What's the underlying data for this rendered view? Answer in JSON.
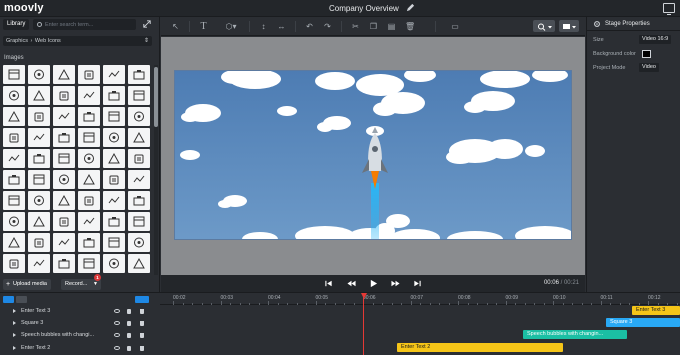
{
  "app": {
    "logo": "moovly",
    "project_title": "Company Overview"
  },
  "library": {
    "tab_label": "Library",
    "search_placeholder": "Enter search term...",
    "breadcrumb": [
      "Graphics",
      "Web Icons"
    ],
    "section_label": "Images",
    "upload_label": "Upload media",
    "record_label": "Record...",
    "notification_count": "1"
  },
  "stage_properties": {
    "title": "Stage Properties",
    "size_label": "Size",
    "size_value": "Video 16:9",
    "background_label": "Background color",
    "background_color": "#000000",
    "mode_label": "Project Mode",
    "mode_value": "Video"
  },
  "playback": {
    "current_time": "00:06",
    "total_time": "/ 00:21"
  },
  "timeline": {
    "ruler_labels": [
      "00:02",
      "00:03",
      "00:04",
      "00:05",
      "00:06",
      "00:07",
      "00:08",
      "00:09",
      "00:10",
      "00:11",
      "00:12"
    ],
    "layers": [
      "Enter Text 3",
      "Square 3",
      "Speech bubbles with changi...",
      "Enter Text 2"
    ],
    "clips": [
      "Enter Text 3",
      "Square 3",
      "Speech bubbles with changin...",
      "Enter Text 2"
    ]
  },
  "colors": {
    "accent_blue": "#1e88e5",
    "playhead": "#e53935",
    "clip_yellow": "#f5c518",
    "clip_teal": "#1bbfa4",
    "clip_blue": "#29a9f5"
  }
}
